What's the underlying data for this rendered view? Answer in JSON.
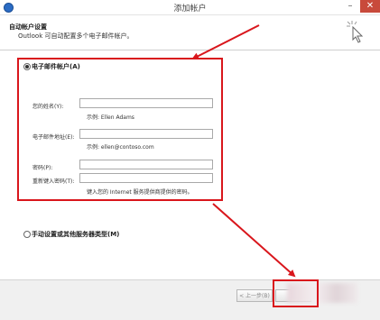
{
  "window": {
    "title": "添加帐户"
  },
  "header": {
    "title": "自动帐户设置",
    "subtitle": "Outlook 可自动配置多个电子邮件帐户。"
  },
  "options": {
    "email_account_label": "电子邮件帐户(A)",
    "manual_setup_label": "手动设置或其他服务器类型(M)"
  },
  "form": {
    "name_label": "您的姓名(Y):",
    "name_value": "",
    "name_hint": "示例: Ellen Adams",
    "email_label": "电子邮件地址(E):",
    "email_value": "",
    "email_hint": "示例: ellen@contoso.com",
    "password_label": "密码(P):",
    "password_value": "",
    "retype_label": "重新键入密码(T):",
    "retype_value": "",
    "password_hint": "键入您的 Internet 服务提供商提供的密码。"
  },
  "footer": {
    "back_label": "< 上一步(B)",
    "next_label": "下"
  },
  "colors": {
    "annotation_red": "#d9161c"
  }
}
